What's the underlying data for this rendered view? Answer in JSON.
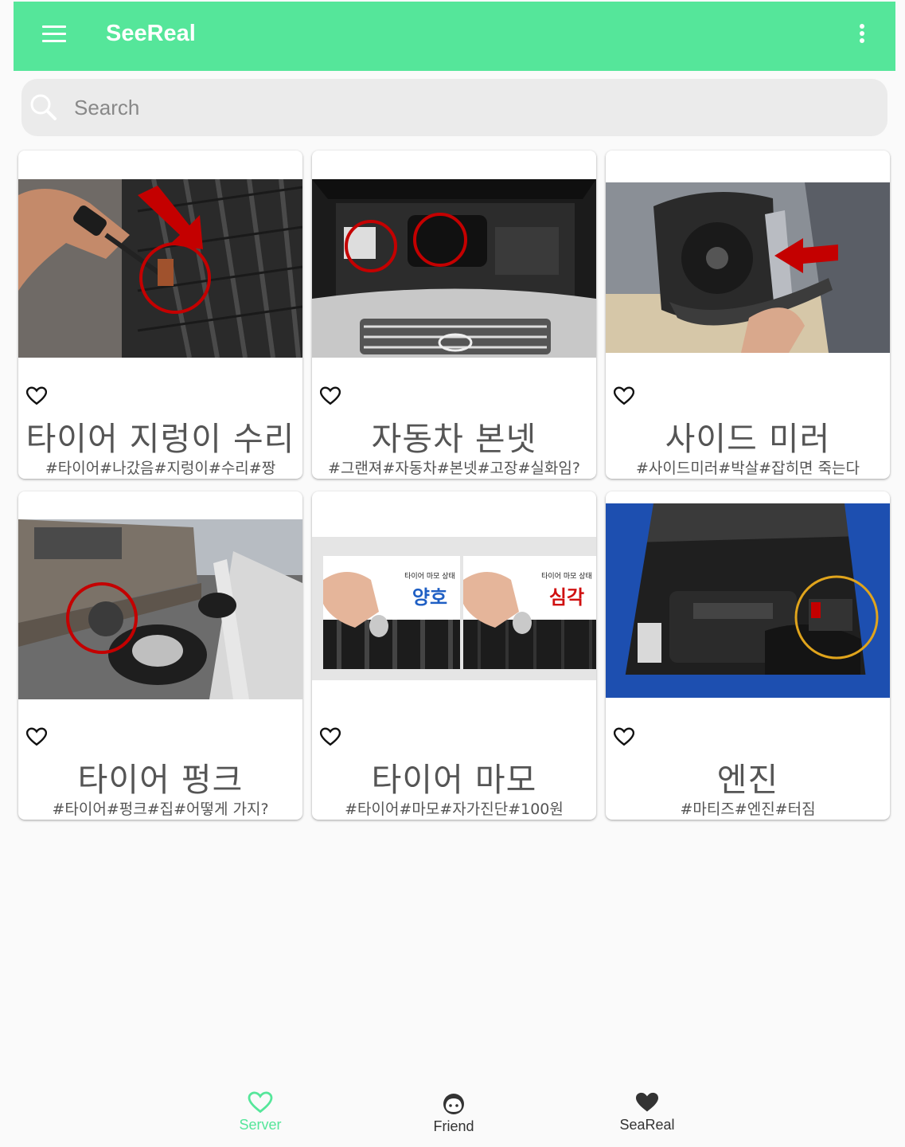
{
  "appbar": {
    "title": "SeeReal",
    "color": "#55e69a"
  },
  "search": {
    "placeholder": "Search"
  },
  "cards": [
    {
      "title": "타이어 지렁이 수리",
      "tags": "#타이어#나갔음#지렁이#수리#짱",
      "image": "tire-plug-repair-photo"
    },
    {
      "title": "자동차 본넷",
      "tags": "#그랜져#자동차#본넷#고장#실화임?",
      "image": "car-engine-bay-photo"
    },
    {
      "title": "사이드 미러",
      "tags": "#사이드미러#박살#잡히면 죽는다",
      "image": "side-mirror-photo"
    },
    {
      "title": "타이어 펑크",
      "tags": "#타이어#펑크#집#어떻게 가지?",
      "image": "flat-tire-roadside-photo"
    },
    {
      "title": "타이어 마모",
      "tags": "#타이어#마모#자가진단#100원",
      "image": "tire-tread-coin-test-photo",
      "image_text": {
        "left_caption": "타이어 마모 상태",
        "left_status": "양호",
        "right_caption": "타이어 마모 상태",
        "right_status": "심각"
      }
    },
    {
      "title": "엔진",
      "tags": "#마티즈#엔진#터짐",
      "image": "engine-bay-battery-photo"
    }
  ],
  "bottom_nav": [
    {
      "label": "Server",
      "icon": "heart-outline-icon",
      "active": true
    },
    {
      "label": "Friend",
      "icon": "face-icon",
      "active": false
    },
    {
      "label": "SeaReal",
      "icon": "heart-filled-icon",
      "active": false
    }
  ]
}
